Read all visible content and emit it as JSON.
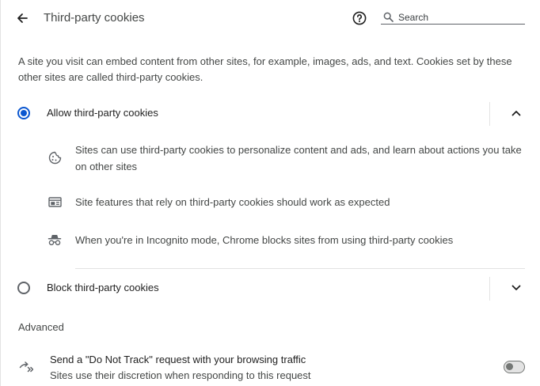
{
  "header": {
    "title": "Third-party cookies",
    "back_icon": "arrow-back-icon",
    "help_icon": "help-circle-icon",
    "search_placeholder": "Search"
  },
  "description": "A site you visit can embed content from other sites, for example, images, ads, and text. Cookies set by these other sites are called third-party cookies.",
  "options": [
    {
      "label": "Allow third-party cookies",
      "selected": true,
      "expanded": true,
      "bullets": [
        {
          "icon": "cookie-icon",
          "text": "Sites can use third-party cookies to personalize content and ads, and learn about actions you take on other sites"
        },
        {
          "icon": "web-page-icon",
          "text": "Site features that rely on third-party cookies should work as expected"
        },
        {
          "icon": "incognito-icon",
          "text": "When you're in Incognito mode, Chrome blocks sites from using third-party cookies"
        }
      ]
    },
    {
      "label": "Block third-party cookies",
      "selected": false,
      "expanded": false
    }
  ],
  "advanced": {
    "heading": "Advanced",
    "do_not_track": {
      "icon": "do-not-track-icon",
      "title": "Send a \"Do Not Track\" request with your browsing traffic",
      "subtitle": "Sites use their discretion when responding to this request",
      "enabled": false
    }
  },
  "colors": {
    "accent": "#0b57d0",
    "text_primary": "#1f1f1f",
    "text_secondary": "#444746",
    "divider": "#e3e3e3"
  }
}
